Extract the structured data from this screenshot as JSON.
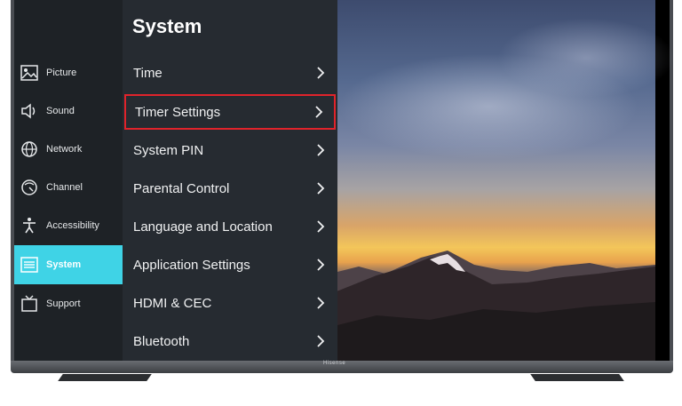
{
  "system_menu": {
    "title": "System",
    "items": [
      {
        "label": "Time",
        "icon": "chevron-right-icon"
      },
      {
        "label": "Timer Settings",
        "icon": "chevron-right-icon",
        "highlighted": true
      },
      {
        "label": "System PIN",
        "icon": "chevron-right-icon"
      },
      {
        "label": "Parental Control",
        "icon": "chevron-right-icon"
      },
      {
        "label": "Language and Location",
        "icon": "chevron-right-icon"
      },
      {
        "label": "Application Settings",
        "icon": "chevron-right-icon"
      },
      {
        "label": "HDMI & CEC",
        "icon": "chevron-right-icon"
      },
      {
        "label": "Bluetooth",
        "icon": "chevron-right-icon"
      }
    ]
  },
  "sidebar": {
    "items": [
      {
        "label": "Picture",
        "icon": "picture-icon"
      },
      {
        "label": "Sound",
        "icon": "speaker-icon"
      },
      {
        "label": "Network",
        "icon": "globe-icon"
      },
      {
        "label": "Channel",
        "icon": "channel-dial-icon"
      },
      {
        "label": "Accessibility",
        "icon": "accessibility-icon"
      },
      {
        "label": "System",
        "icon": "system-list-icon",
        "active": true
      },
      {
        "label": "Support",
        "icon": "tv-support-icon"
      }
    ]
  },
  "tv": {
    "brand": "Hisense"
  },
  "colors": {
    "accent": "#3fd3e6",
    "highlight": "#e0232b",
    "panel": "#262b31",
    "sidebar": "#1e2226"
  }
}
